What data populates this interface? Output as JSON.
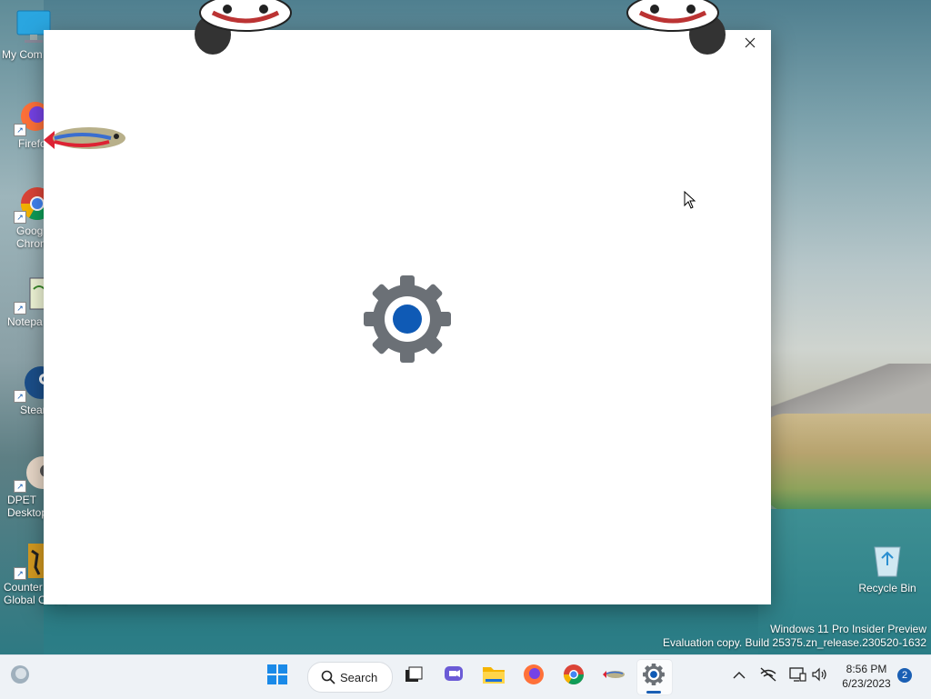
{
  "desktop": {
    "icons": [
      {
        "label": "My Com",
        "icon": "monitor-icon"
      },
      {
        "label": "Firefo",
        "icon": "firefox-icon"
      },
      {
        "label": "Goog\nChrom",
        "icon": "chrome-icon"
      },
      {
        "label": "Notepa",
        "icon": "notepad-icon"
      },
      {
        "label": "Stean",
        "icon": "steam-icon"
      },
      {
        "label": "DPET\nDesktop",
        "icon": "dpet-icon"
      },
      {
        "label": "Counter\nGlobal Offe...",
        "icon": "csgo-icon"
      }
    ],
    "recycle_bin": "Recycle Bin",
    "watermark": {
      "line1": "Windows 11 Pro Insider Preview",
      "line2": "Evaluation copy. Build 25375.zn_release.230520-1632"
    }
  },
  "window": {
    "minimize_icon": "minimize-icon",
    "close_icon": "close-icon",
    "center_icon": "settings-gear-icon"
  },
  "taskbar": {
    "search_label": "Search",
    "time": "8:56 PM",
    "date": "6/23/2023",
    "notification_count": "2",
    "apps": [
      "start-icon",
      "search-icon",
      "task-view-icon",
      "chat-icon",
      "file-explorer-icon",
      "firefox-icon",
      "chrome-icon",
      "fish-icon",
      "settings-icon"
    ],
    "tray": [
      "chevron-up-icon",
      "network-off-icon",
      "display-icon",
      "speaker-icon"
    ]
  },
  "colors": {
    "accent": "#1a5fb4",
    "taskbar_bg": "#eef2f6",
    "gear_gray": "#6b7076",
    "gear_blue": "#0f5ab5"
  }
}
